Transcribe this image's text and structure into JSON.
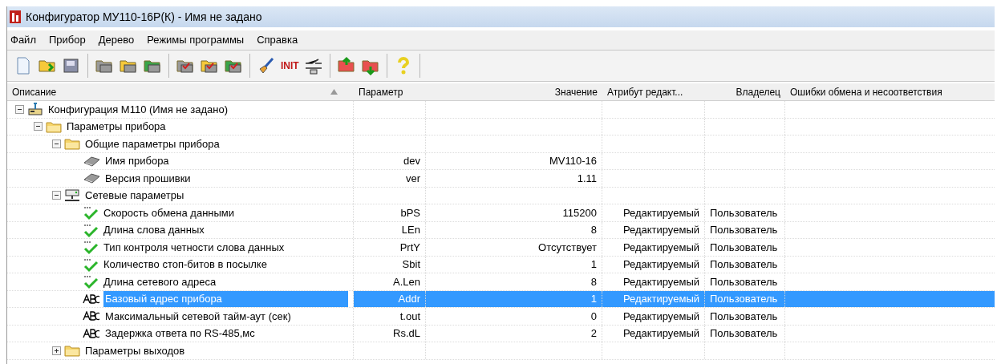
{
  "window": {
    "title": "Конфигуратор МУ110-16Р(К) - Имя не задано"
  },
  "menu": [
    "Файл",
    "Прибор",
    "Дерево",
    "Режимы программы",
    "Справка"
  ],
  "toolbar": {
    "init_label": "INIT"
  },
  "table": {
    "columns": [
      {
        "label": "Описание",
        "sorted": true
      },
      {
        "label": "Параметр",
        "sorted": false
      },
      {
        "label": "Значение",
        "sorted": false
      },
      {
        "label": "Атрибут редакт...",
        "sorted": false
      },
      {
        "label": "Владелец",
        "sorted": false
      },
      {
        "label": "Ошибки обмена и несоответствия",
        "sorted": false
      }
    ],
    "rows": [
      {
        "kind": "config",
        "description": "Конфигурация М110 (Имя не задано)",
        "expanded": true,
        "selected": false,
        "children": [
          {
            "kind": "folder",
            "description": "Параметры прибора",
            "expanded": true,
            "selected": false,
            "children": [
              {
                "kind": "folder",
                "description": "Общие параметры прибора",
                "expanded": true,
                "selected": false,
                "children": [
                  {
                    "kind": "chip",
                    "description": "Имя прибора",
                    "parameter": "dev",
                    "value": "MV110-16",
                    "selected": false
                  },
                  {
                    "kind": "chip",
                    "description": "Версия прошивки",
                    "parameter": "ver",
                    "value": "1.11",
                    "selected": false
                  }
                ]
              },
              {
                "kind": "network",
                "description": "Сетевые параметры",
                "expanded": true,
                "selected": false,
                "children": [
                  {
                    "kind": "check",
                    "description": "Скорость обмена данными",
                    "parameter": "bPS",
                    "value": "115200",
                    "attribute": "Редактируемый",
                    "owner": "Пользователь",
                    "selected": false
                  },
                  {
                    "kind": "check",
                    "description": "Длина слова данных",
                    "parameter": "LEn",
                    "value": "8",
                    "attribute": "Редактируемый",
                    "owner": "Пользователь",
                    "selected": false
                  },
                  {
                    "kind": "check",
                    "description": "Тип контроля четности слова данных",
                    "parameter": "PrtY",
                    "value": "Отсутствует",
                    "attribute": "Редактируемый",
                    "owner": "Пользователь",
                    "selected": false
                  },
                  {
                    "kind": "check",
                    "description": "Количество стоп-битов в посылке",
                    "parameter": "Sbit",
                    "value": "1",
                    "attribute": "Редактируемый",
                    "owner": "Пользователь",
                    "selected": false
                  },
                  {
                    "kind": "check",
                    "description": "Длина сетевого адреса",
                    "parameter": "A.Len",
                    "value": "8",
                    "attribute": "Редактируемый",
                    "owner": "Пользователь",
                    "selected": false
                  },
                  {
                    "kind": "abc",
                    "description": "Базовый адрес прибора",
                    "parameter": "Addr",
                    "value": "1",
                    "attribute": "Редактируемый",
                    "owner": "Пользователь",
                    "selected": true
                  },
                  {
                    "kind": "abc",
                    "description": "Максимальный сетевой тайм-аут (сек)",
                    "parameter": "t.out",
                    "value": "0",
                    "attribute": "Редактируемый",
                    "owner": "Пользователь",
                    "selected": false
                  },
                  {
                    "kind": "abc",
                    "description": "Задержка ответа по RS-485,мс",
                    "parameter": "Rs.dL",
                    "value": "2",
                    "attribute": "Редактируемый",
                    "owner": "Пользователь",
                    "selected": false
                  }
                ]
              },
              {
                "kind": "folder",
                "description": "Параметры выходов",
                "expanded": false,
                "selected": false
              }
            ]
          }
        ]
      }
    ]
  }
}
